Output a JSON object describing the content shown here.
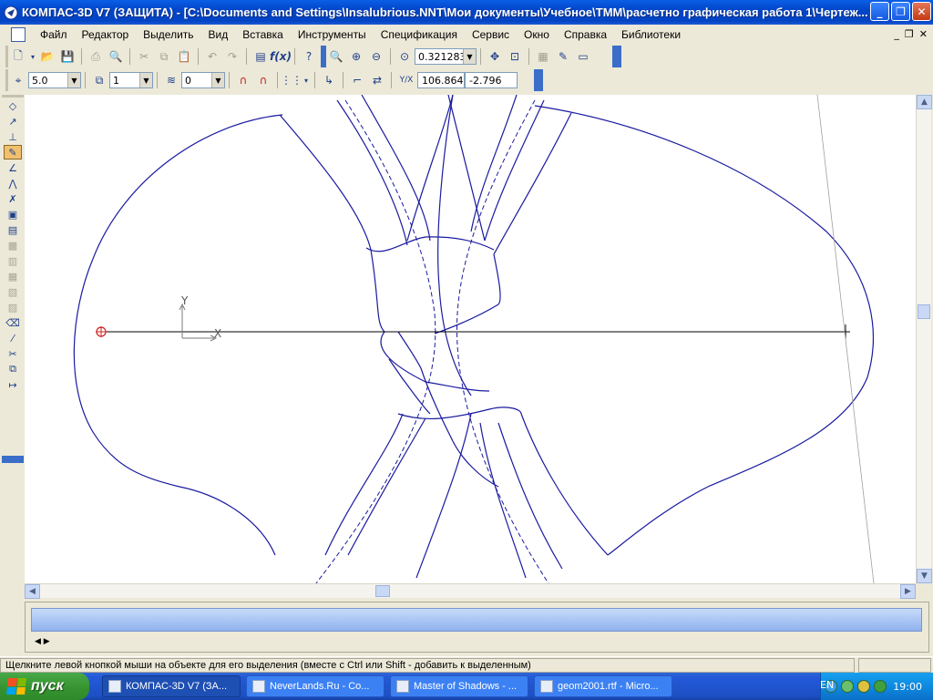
{
  "window": {
    "title": "КОМПАС-3D V7 (ЗАЩИТА) - [C:\\Documents and Settings\\Insalubrious.NNT\\Мои документы\\Учебное\\ТММ\\расчетно графическая работа 1\\Чертеж...",
    "icon": "kompas-icon"
  },
  "menu": {
    "items": [
      "Файл",
      "Редактор",
      "Выделить",
      "Вид",
      "Вставка",
      "Инструменты",
      "Спецификация",
      "Сервис",
      "Окно",
      "Справка",
      "Библиотеки"
    ]
  },
  "toolbar": {
    "zoom_value": "0.321283"
  },
  "toolbar2": {
    "step_value": "5.0",
    "layer_value": "1",
    "style_value": "0",
    "coord_label": "Y/X",
    "coord_x": "106.864",
    "coord_y": "-2.796"
  },
  "canvas": {
    "axis_y_label": "Y",
    "axis_x_label": "X",
    "line_color": "#1a1aa0"
  },
  "statusbar": {
    "message": "Щелкните левой кнопкой мыши на объекте для его выделения (вместе с Ctrl или Shift - добавить к выделенным)"
  },
  "taskbar": {
    "start_label": "пуск",
    "tasks": [
      {
        "label": "КОМПАС-3D V7 (ЗА...",
        "icon": "kompas-icon"
      },
      {
        "label": "NeverLands.Ru - Co...",
        "icon": "browser-icon"
      },
      {
        "label": "Master of Shadows - ...",
        "icon": "window-icon"
      },
      {
        "label": "geom2001.rtf - Micro...",
        "icon": "word-icon"
      }
    ],
    "lang": "EN",
    "clock": "19:00"
  }
}
